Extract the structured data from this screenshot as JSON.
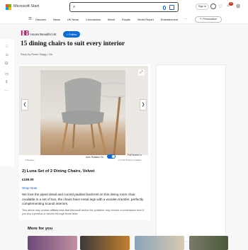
{
  "topbar": {
    "brand": "Microsoft Start",
    "signin_label": "Sign in",
    "notifications_count": "5",
    "logo_colors": [
      "#f25022",
      "#7fba00",
      "#00a4ef",
      "#ffb900"
    ]
  },
  "nav": {
    "items": [
      "Discover",
      "News",
      "UK News",
      "Coronavirus",
      "Brexit",
      "Royals",
      "World Report",
      "Entertainment"
    ],
    "more_label": "···",
    "personalize_label": "Personalise"
  },
  "publisher": {
    "logo_text": "HB",
    "name": "House Beautiful UK",
    "follow_label": "+ Follow"
  },
  "article": {
    "title": "15 dining chairs to suit every interior",
    "byline": "Story by Rosie Stagg • 2w"
  },
  "gallery": {
    "credit": "© Dunelm",
    "auto_rotation_label": "Auto Rotation On",
    "full_screen_label": "Full Screen",
    "counter": "2 of 16 Photos in Gallery",
    "item_title": "2) Luna Set of 2 Dining Chairs, Velvet",
    "price": "£169.00",
    "shop_label": "Shop Now",
    "description": "We love the piped detail and curved padded backrest on this dining room chair. Available in a set of two, the chairs have metal legs with a wooden transfer, perfectly complementing Scandi interiors.",
    "disclaimer": "This article may contain affiliate links that Microsoft and/or the publisher may receive a commission from if you buy a product or service through those links."
  },
  "more_for_you": {
    "title": "More for you"
  },
  "colors": {
    "accent": "#0a6cd6",
    "publisher_brand": "#a8206a"
  }
}
